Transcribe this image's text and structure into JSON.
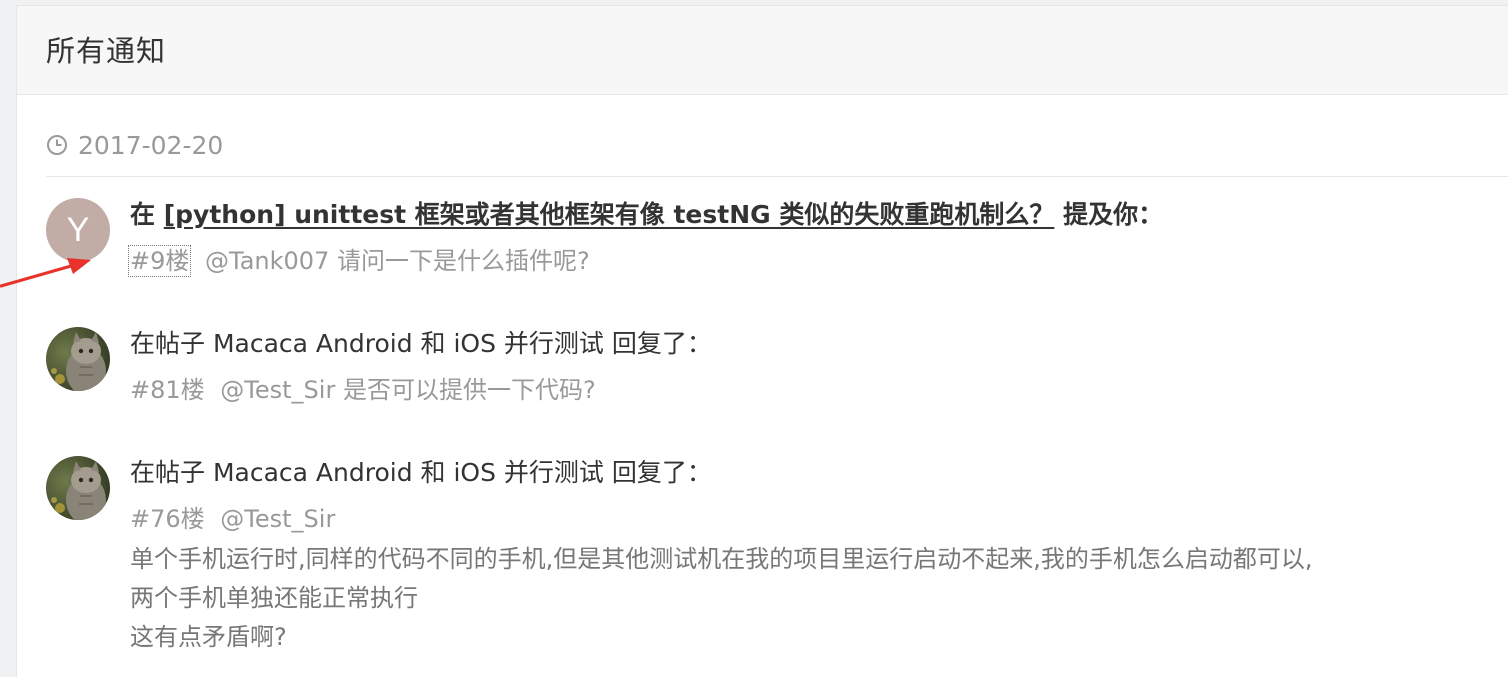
{
  "header": {
    "title": "所有通知"
  },
  "date_group": {
    "date": "2017-02-20"
  },
  "notifications": [
    {
      "avatar_letter": "Y",
      "prefix": "在",
      "topic": "[python] unittest 框架或者其他框架有像 testNG 类似的失败重跑机制么？",
      "suffix": "提及你：",
      "floor": "#9楼",
      "mention": "@Tank007",
      "content": "请问一下是什么插件呢?"
    },
    {
      "avatar": "cat-photo",
      "prefix": "在帖子",
      "topic": "Macaca Android 和 iOS 并行测试",
      "suffix": "回复了：",
      "floor": "#81楼",
      "mention": "@Test_Sir",
      "content": "是否可以提供一下代码?"
    },
    {
      "avatar": "cat-photo",
      "prefix": "在帖子",
      "topic": "Macaca Android 和 iOS 并行测试",
      "suffix": "回复了：",
      "floor": "#76楼",
      "mention": "@Test_Sir",
      "content_lines": [
        "单个手机运行时,同样的代码不同的手机,但是其他测试机在我的项目里运行启动不起来,我的手机怎么启动都可以,",
        "两个手机单独还能正常执行",
        "这有点矛盾啊?"
      ]
    }
  ],
  "annotation": {
    "type": "red-arrow",
    "color": "#e8322b"
  },
  "colors": {
    "title_text": "#333333",
    "meta_text": "#999999",
    "avatar_bg": "#c2aca6"
  }
}
